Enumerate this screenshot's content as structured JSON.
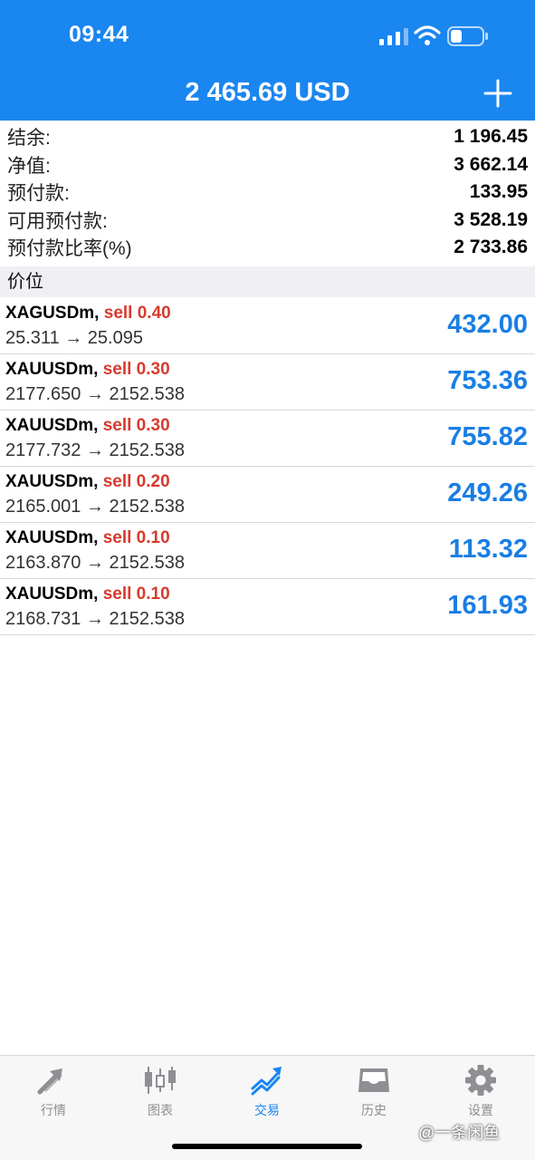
{
  "status_bar": {
    "time": "09:44"
  },
  "header": {
    "title": "2 465.69 USD"
  },
  "summary": [
    {
      "label": "结余:",
      "value": "1 196.45"
    },
    {
      "label": "净值:",
      "value": "3 662.14"
    },
    {
      "label": "预付款:",
      "value": "133.95"
    },
    {
      "label": "可用预付款:",
      "value": "3 528.19"
    },
    {
      "label": "预付款比率(%)",
      "value": "2 733.86"
    }
  ],
  "section_title": "价位",
  "positions": [
    {
      "symbol": "XAGUSDm,",
      "side": "sell 0.40",
      "prices": "25.311 → 25.095",
      "profit": "432.00"
    },
    {
      "symbol": "XAUUSDm,",
      "side": "sell 0.30",
      "prices": "2177.650 → 2152.538",
      "profit": "753.36"
    },
    {
      "symbol": "XAUUSDm,",
      "side": "sell 0.30",
      "prices": "2177.732 → 2152.538",
      "profit": "755.82"
    },
    {
      "symbol": "XAUUSDm,",
      "side": "sell 0.20",
      "prices": "2165.001 → 2152.538",
      "profit": "249.26"
    },
    {
      "symbol": "XAUUSDm,",
      "side": "sell 0.10",
      "prices": "2163.870 → 2152.538",
      "profit": "113.32"
    },
    {
      "symbol": "XAUUSDm,",
      "side": "sell 0.10",
      "prices": "2168.731 → 2152.538",
      "profit": "161.93"
    }
  ],
  "tabs": [
    {
      "label": "行情",
      "icon": "quotes-arrows-icon",
      "active": false
    },
    {
      "label": "图表",
      "icon": "candlestick-chart-icon",
      "active": false
    },
    {
      "label": "交易",
      "icon": "trade-trend-icon",
      "active": true
    },
    {
      "label": "历史",
      "icon": "history-inbox-icon",
      "active": false
    },
    {
      "label": "设置",
      "icon": "gear-icon",
      "active": false
    }
  ],
  "watermark": "@一条闲鱼",
  "colors": {
    "accent": "#1a86f0",
    "sell": "#d83a2e",
    "profit": "#1a7ee3",
    "section_bg": "#efeff4"
  }
}
